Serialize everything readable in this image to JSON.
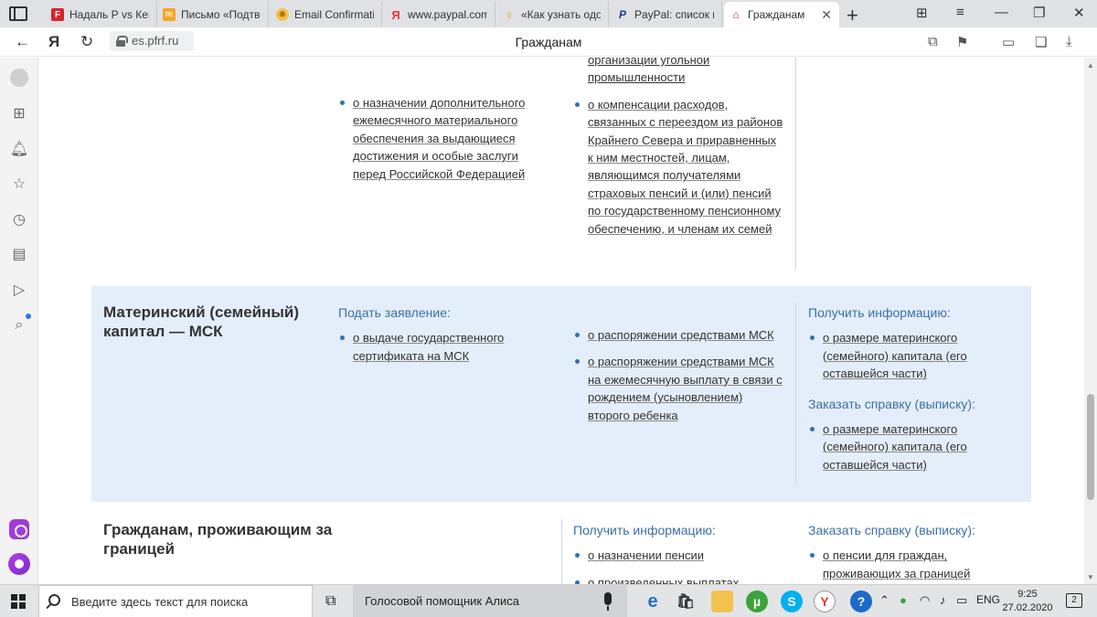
{
  "browser": {
    "tabs": [
      {
        "title": "Надаль Р vs Кецм",
        "icon": "flashscore-icon",
        "color": "#d8232a",
        "letter": "F"
      },
      {
        "title": "Письмо «Подтве",
        "icon": "mail-icon",
        "color": "#f5a623",
        "letter": "✉"
      },
      {
        "title": "Email Confirmatio",
        "icon": "sun-icon",
        "color": "#e8a317",
        "letter": "☀"
      },
      {
        "title": "www.paypal.com",
        "icon": "yandex-icon",
        "color": "#e53935",
        "letter": "Я"
      },
      {
        "title": "«Как узнать одо",
        "icon": "bulb-icon",
        "color": "#f2b705",
        "letter": "💡"
      },
      {
        "title": "PayPal: список ко",
        "icon": "paypal-icon",
        "color": "#1f3f8f",
        "letter": "P"
      },
      {
        "title": "Гражданам",
        "icon": "pfr-icon",
        "color": "#c0392b",
        "letter": "⌂",
        "close": "✕"
      }
    ],
    "url": "es.pfrf.ru",
    "page_title": "Гражданам"
  },
  "content": {
    "top": {
      "col2_item": "о назначении дополнительного ежемесячного материального обеспечения за выдающиеся достижения и особые заслуги перед Российской Федерацией",
      "col3_top_fragment": "организации угольной промышленности",
      "col3_item": "о компенсации расходов, связанных с переездом из районов Крайнего Севера и приравненных к ним местностей, лицам, являющимся получателями страховых пенсий и (или) пенсий по государственному пенсионному обеспечению, и членам их семей"
    },
    "msk": {
      "title": "Материнский (семейный) капитал — МСК",
      "apply_head": "Подать заявление:",
      "apply_item": "о выдаче государственного сертификата на МСК",
      "mid_items": [
        "о распоряжении средствами МСК",
        "о распоряжении средствами МСК на ежемесячную выплату в связи с рождением (усыновлением) второго ребенка"
      ],
      "info_head": "Получить информацию:",
      "info_item": "о размере материнского (семейного) капитала (его оставшейся части)",
      "cert_head": "Заказать справку (выписку):",
      "cert_item": "о размере материнского (семейного) капитала (его оставшейся части)"
    },
    "abroad": {
      "title": "Гражданам, проживающим за границей",
      "info_head": "Получить информацию:",
      "info_items": [
        "о назначении пенсии",
        "о произведенных выплатах"
      ],
      "cert_head": "Заказать справку (выписку):",
      "cert_item": "о пенсии для граждан, проживающих за границей"
    }
  },
  "taskbar": {
    "search_placeholder": "Введите здесь текст для поиска",
    "alice_label": "Голосовой помощник Алиса",
    "lang": "ENG",
    "time": "9:25",
    "date": "27.02.2020",
    "notifications": "2"
  }
}
